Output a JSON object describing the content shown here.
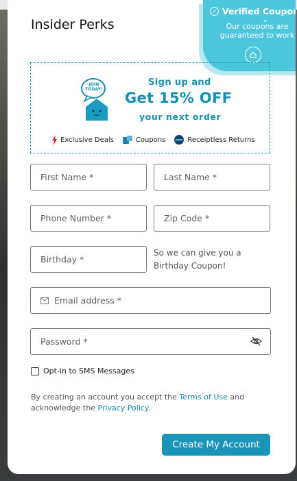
{
  "modal": {
    "title": "Insider Perks"
  },
  "badge": {
    "title": "Verified Coupon",
    "subtitle": "Our coupons are guaranteed to work"
  },
  "promo": {
    "mascot_sign": "JOIN TODAY!",
    "line1": "Sign up and",
    "line2": "Get 15% OFF",
    "line3": "your next order",
    "perks": [
      {
        "label": "Exclusive Deals",
        "icon": "lightning-icon"
      },
      {
        "label": "Coupons",
        "icon": "coupon-icon"
      },
      {
        "label": "Receiptless Returns",
        "icon": "returns-icon"
      }
    ]
  },
  "form": {
    "first_name": "First Name *",
    "last_name": "Last Name *",
    "phone": "Phone Number *",
    "zip": "Zip Code *",
    "birthday": "Birthday *",
    "birthday_help": "So we can give you a Birthday Coupon!",
    "email": "Email address *",
    "password": "Password *",
    "sms_label": "Opt-in to SMS Messages",
    "legal_prefix": "By creating an account you accept the ",
    "terms_link": "Terms of Use",
    "legal_mid": " and acknowledge the ",
    "privacy_link": "Privacy Policy",
    "legal_suffix": ".",
    "submit": "Create My Account"
  },
  "colors": {
    "accent": "#1a95b9",
    "badge": "#4cc6dc"
  }
}
